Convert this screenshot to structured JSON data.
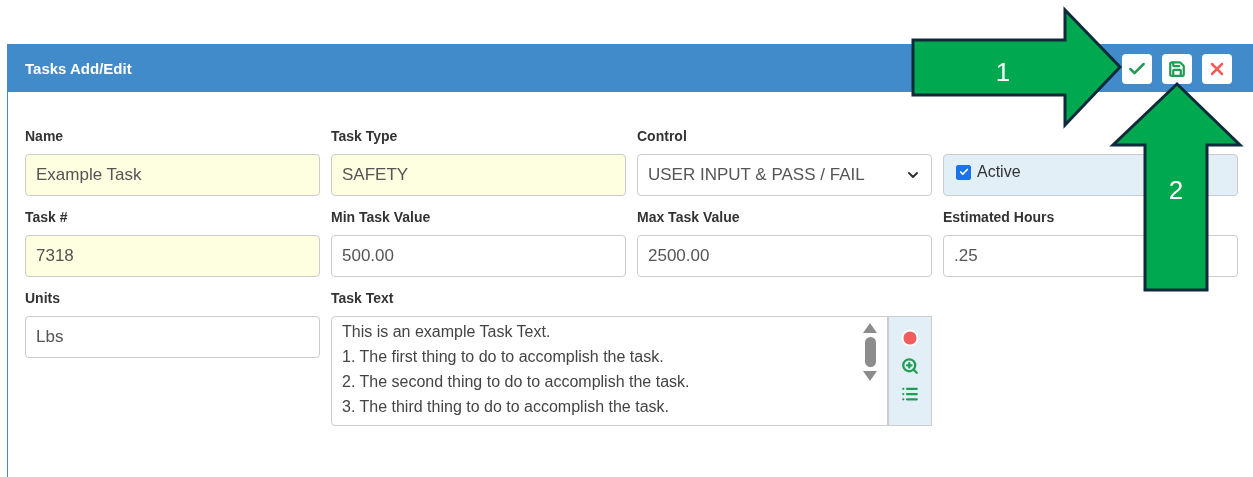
{
  "panel": {
    "title": "Tasks Add/Edit",
    "actions": [
      {
        "kind": "confirm"
      },
      {
        "kind": "save"
      },
      {
        "kind": "cancel"
      }
    ]
  },
  "fields": [
    {
      "kind": "input",
      "label": "Name",
      "value": "Example Task",
      "required": true
    },
    {
      "kind": "input",
      "label": "Task Type",
      "value": "SAFETY",
      "required": true
    },
    {
      "kind": "select",
      "label": "Control",
      "value": "USER INPUT & PASS / FAIL",
      "required": false
    },
    {
      "kind": "checkbox",
      "label": "Active",
      "checked": true
    },
    {
      "kind": "input",
      "label": "Task #",
      "value": "7318",
      "required": true
    },
    {
      "kind": "input",
      "label": "Min Task Value",
      "value": "500.00",
      "required": false
    },
    {
      "kind": "input",
      "label": "Max Task Value",
      "value": "2500.00",
      "required": false
    },
    {
      "kind": "input",
      "label": "Estimated Hours",
      "value": ".25",
      "required": false
    },
    {
      "kind": "input",
      "label": "Units",
      "value": "Lbs",
      "required": false
    },
    {
      "kind": "textarea",
      "label": "Task Text",
      "lines": [
        "This is an example Task Text.",
        "1. The first thing to do to accomplish the task.",
        "2. The second thing to do to accomplish the task.",
        "3. The third thing to do to accomplish the task."
      ]
    }
  ],
  "callouts": [
    {
      "label": "1",
      "kind": "right"
    },
    {
      "label": "2",
      "kind": "up"
    }
  ]
}
